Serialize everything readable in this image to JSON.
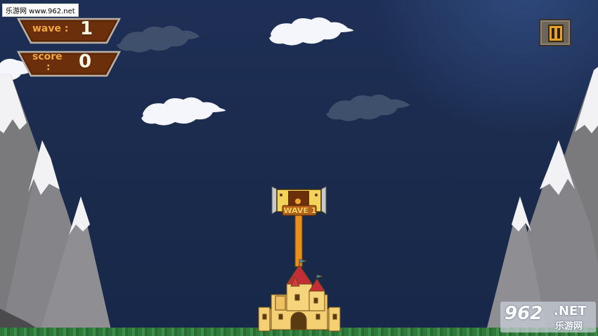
{
  "watermark": {
    "text": "乐游网 www.962.net"
  },
  "hud": {
    "wave_label": "wave :",
    "wave_value": "1",
    "score_label_line1": "score",
    "score_label_line2": ":",
    "score_value": "0"
  },
  "pause_button": {
    "icon": "pause-icon"
  },
  "wave_banner": {
    "text": "WAVE 1"
  },
  "logo": {
    "number": "962",
    "suffix": ".NET",
    "chinese": "乐游网"
  },
  "colors": {
    "sky": "#1b2a4e",
    "hud_fill": "#6b2f0c",
    "hud_text": "#f4a63c",
    "pause_fill": "#e5a12b"
  }
}
